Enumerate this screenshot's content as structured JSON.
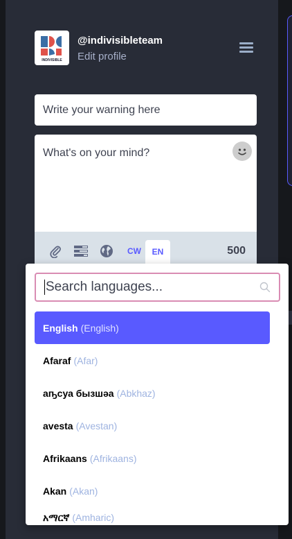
{
  "account": {
    "handle": "@indivisibleteam",
    "edit_profile_label": "Edit profile",
    "avatar_text": "INDIVISIBLE",
    "menu_icon": "hamburger-icon"
  },
  "compose": {
    "cw_placeholder": "Write your warning here",
    "text_placeholder": "What's on your mind?",
    "emoji_icon": "emoji-icon",
    "toolbar": {
      "attach_icon": "paperclip-icon",
      "poll_icon": "poll-icon",
      "privacy_icon": "globe-icon",
      "cw_label": "CW",
      "language_label": "EN",
      "char_count": "500"
    }
  },
  "language_picker": {
    "search_placeholder": "Search languages...",
    "search_icon": "search-icon",
    "items": [
      {
        "native": "English",
        "english": "(English)",
        "selected": true
      },
      {
        "native": "Afaraf",
        "english": "(Afar)",
        "selected": false
      },
      {
        "native": "аҧсуа бызшәа",
        "english": "(Abkhaz)",
        "selected": false
      },
      {
        "native": "avesta",
        "english": "(Avestan)",
        "selected": false
      },
      {
        "native": "Afrikaans",
        "english": "(Afrikaans)",
        "selected": false
      },
      {
        "native": "Akan",
        "english": "(Akan)",
        "selected": false
      },
      {
        "native": "አማርኛ",
        "english": "(Amharic)",
        "selected": false
      }
    ]
  },
  "colors": {
    "accent": "#595aff",
    "sidebar_bg": "#282c37",
    "toolbar_bg": "#d9e1e8",
    "search_border": "#d98cb3"
  }
}
